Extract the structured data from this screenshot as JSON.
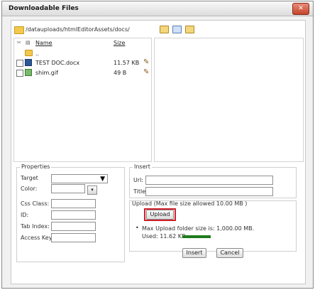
{
  "window": {
    "title": "Downloadable Files",
    "close_label": "✕"
  },
  "pathbar": {
    "path": "/datauploads/htmlEditorAssets/docs/",
    "tools": [
      "new-folder-icon",
      "copy-icon",
      "paste-icon"
    ]
  },
  "filelist": {
    "columns": {
      "name": "Name",
      "size": "Size"
    },
    "parent_label": "..",
    "rows": [
      {
        "name": "TEST DOC.docx",
        "size": "11.57 KB",
        "icon": "word-doc-icon"
      },
      {
        "name": "shim.gif",
        "size": "49 B",
        "icon": "image-file-icon"
      }
    ]
  },
  "properties": {
    "legend": "Properties",
    "target_label": "Target",
    "target_value": "",
    "color_label": "Color:",
    "color_value": "",
    "css_class_label": "Css Class:",
    "css_class_value": "",
    "id_label": "ID:",
    "id_value": "",
    "tab_index_label": "Tab Index:",
    "tab_index_value": "",
    "access_key_label": "Access Key:",
    "access_key_value": ""
  },
  "insert": {
    "legend": "Insert",
    "url_label": "Url:",
    "url_value": "",
    "title_label": "Title:",
    "title_value": ""
  },
  "upload": {
    "legend": "Upload (Max file size allowed 10.00 MB )",
    "button_label": "Upload",
    "max_folder_text": "Max Upload folder size is: 1,000.00 MB.",
    "used_text": "Used: 11.62 KB",
    "used_fraction": 1.16e-05
  },
  "actions": {
    "insert_label": "Insert",
    "cancel_label": "Cancel"
  },
  "colors": {
    "highlight": "#d0202a",
    "usage_fill": "#1e7b1e"
  }
}
